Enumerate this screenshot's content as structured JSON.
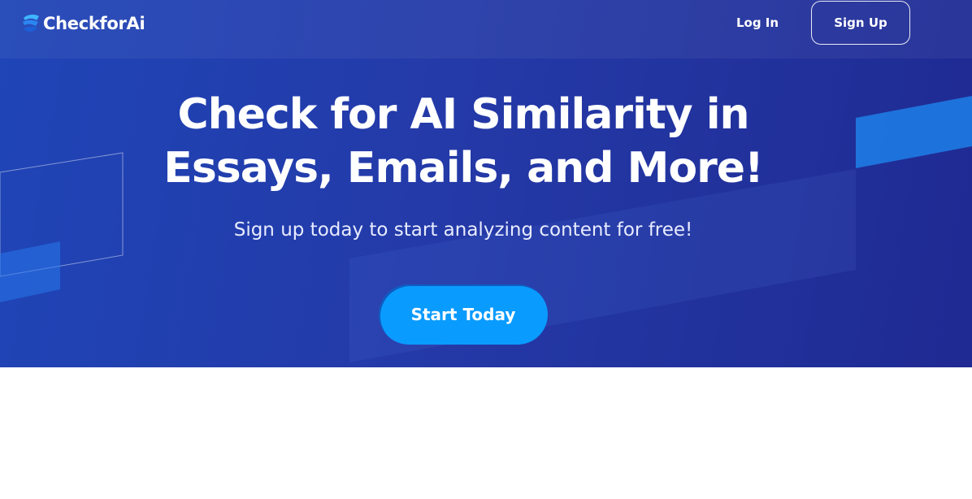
{
  "brand": {
    "name": "CheckforAi",
    "logo_icon": "checkforai-logo-icon"
  },
  "nav": {
    "login_label": "Log In",
    "signup_label": "Sign Up"
  },
  "hero": {
    "headline_line1": "Check for AI Similarity in",
    "headline_line2": "Essays, Emails, and More!",
    "subheadline": "Sign up today to start analyzing content for free!",
    "cta_label": "Start Today"
  },
  "colors": {
    "hero_gradient_start": "#1f45b7",
    "hero_gradient_end": "#1f2a92",
    "cta_background": "#0a9bff",
    "page_background": "#ffffff"
  }
}
